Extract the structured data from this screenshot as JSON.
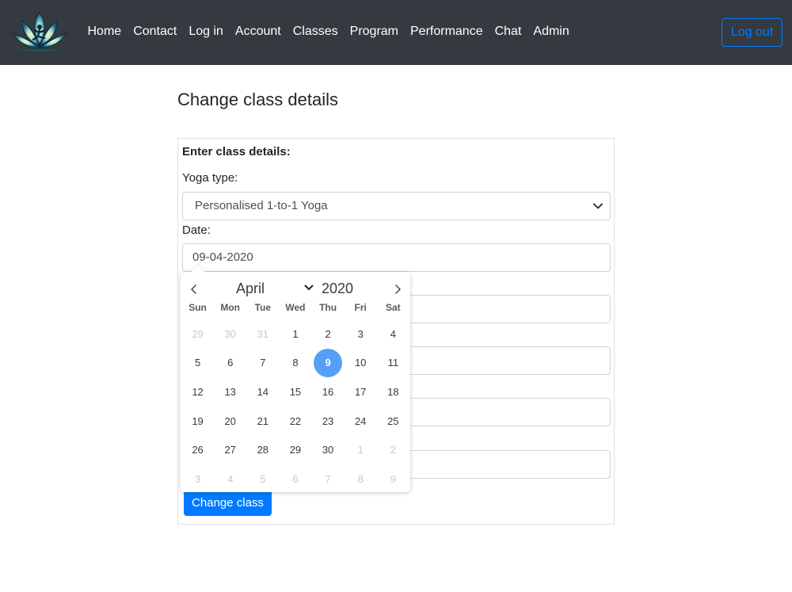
{
  "navbar": {
    "logo_icon": "lotus-yoga-logo-icon",
    "links": [
      "Home",
      "Contact",
      "Log in",
      "Account",
      "Classes",
      "Program",
      "Performance",
      "Chat",
      "Admin"
    ],
    "logout_label": "Log out"
  },
  "page": {
    "title": "Change class details"
  },
  "form": {
    "heading": "Enter class details:",
    "yoga_type_label": "Yoga type:",
    "yoga_type_value": "Personalised 1-to-1 Yoga",
    "date_label": "Date:",
    "date_value": "09-04-2020",
    "submit_label": "Change class"
  },
  "datepicker": {
    "month": "April",
    "year": "2020",
    "weekdays": [
      "Sun",
      "Mon",
      "Tue",
      "Wed",
      "Thu",
      "Fri",
      "Sat"
    ],
    "days": [
      {
        "d": "29",
        "muted": true
      },
      {
        "d": "30",
        "muted": true
      },
      {
        "d": "31",
        "muted": true
      },
      {
        "d": "1"
      },
      {
        "d": "2"
      },
      {
        "d": "3"
      },
      {
        "d": "4"
      },
      {
        "d": "5"
      },
      {
        "d": "6"
      },
      {
        "d": "7"
      },
      {
        "d": "8"
      },
      {
        "d": "9",
        "selected": true
      },
      {
        "d": "10"
      },
      {
        "d": "11"
      },
      {
        "d": "12"
      },
      {
        "d": "13"
      },
      {
        "d": "14"
      },
      {
        "d": "15"
      },
      {
        "d": "16"
      },
      {
        "d": "17"
      },
      {
        "d": "18"
      },
      {
        "d": "19"
      },
      {
        "d": "20"
      },
      {
        "d": "21"
      },
      {
        "d": "22"
      },
      {
        "d": "23"
      },
      {
        "d": "24"
      },
      {
        "d": "25"
      },
      {
        "d": "26"
      },
      {
        "d": "27"
      },
      {
        "d": "28"
      },
      {
        "d": "29"
      },
      {
        "d": "30"
      },
      {
        "d": "1",
        "muted": true
      },
      {
        "d": "2",
        "muted": true
      },
      {
        "d": "3",
        "muted": true
      },
      {
        "d": "4",
        "muted": true
      },
      {
        "d": "5",
        "muted": true
      },
      {
        "d": "6",
        "muted": true
      },
      {
        "d": "7",
        "muted": true
      },
      {
        "d": "8",
        "muted": true
      },
      {
        "d": "9",
        "muted": true
      }
    ],
    "selected_color": "#569ff7"
  },
  "colors": {
    "navbar_bg": "#343a40",
    "primary": "#007bff"
  }
}
